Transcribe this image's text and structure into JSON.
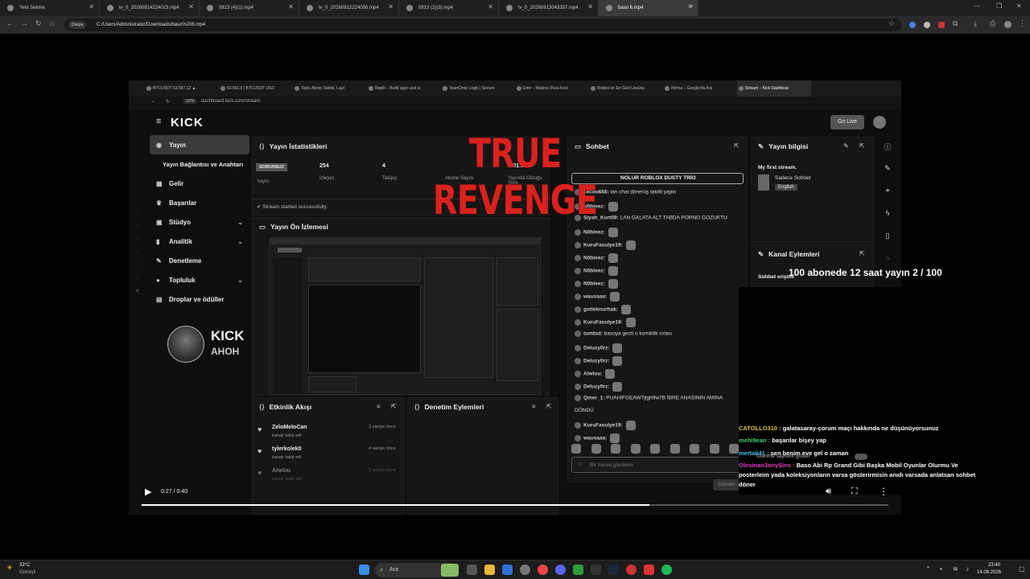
{
  "browser": {
    "tabs": [
      {
        "label": "Yeni Sekme"
      },
      {
        "label": "tv_0_20260814224023.mp4"
      },
      {
        "label": "0813 (4)(1).mp4"
      },
      {
        "label": "tv_0_20260812224056.mp4"
      },
      {
        "label": "0813 (2)(3).mp4"
      },
      {
        "label": "tv_0_20260813043357.mp4"
      },
      {
        "label": "baso 6.mp4"
      }
    ],
    "address_chip": "Dosya",
    "url": "C:/Users/Administrator/Downloads/baso%206.mp4"
  },
  "inner_browser": {
    "tabs": [
      {
        "label": "BTCUSDT 63,587,12 ▲"
      },
      {
        "label": "63,561.5 | BTCUSDT USD"
      },
      {
        "label": "Toplu Akrep Takildi, Laut"
      },
      {
        "label": "Replit – Build apps and si"
      },
      {
        "label": "TeamDrop Login | Secure"
      },
      {
        "label": "Emir – Makina (Kisa Kesi"
      },
      {
        "label": "Roblox'un En Gizli Ussünu"
      },
      {
        "label": "#drma – Google'da Ara"
      },
      {
        "label": "Stream – Kick Dashboar"
      }
    ],
    "chip": "VPN",
    "url": "dashboard.kick.com/stream"
  },
  "kick": {
    "logo": "KICK",
    "go_live": "Go Live",
    "sidebar": [
      {
        "label": "Yayın",
        "icon": "broadcast-icon"
      },
      {
        "label": "Yayın Bağlantısı ve Anahtarı"
      },
      {
        "label": "Gelir",
        "icon": "money-icon"
      },
      {
        "label": "Başarılar",
        "icon": "trophy-icon"
      },
      {
        "label": "Stüdyo",
        "icon": "studio-icon"
      },
      {
        "label": "Analitik",
        "icon": "chart-icon"
      },
      {
        "label": "Denetleme",
        "icon": "wrench-icon"
      },
      {
        "label": "Topluluk",
        "icon": "people-icon"
      },
      {
        "label": "Droplar ve ödüller",
        "icon": "gift-icon"
      }
    ],
    "card": {
      "name": "KICK",
      "sub": "AHOH"
    },
    "stats": {
      "title": "Yayın İstatistikleri",
      "status_badge": "SORUNSUZ",
      "status_label": "Yayın",
      "viewers": "254",
      "viewers_label": "İzleyici",
      "followers": "4",
      "followers_label": "Takipçi",
      "subs_label": "Abone Sayısı",
      "duration": "0:01:25",
      "duration_label": "Yayında Olduğu Süre",
      "notice": "Stream started successfully."
    },
    "preview": {
      "title": "Yayın Ön İzlemesi"
    },
    "activity": {
      "title": "Etkinlik Akışı",
      "items": [
        {
          "user": "ZeloMeloCan",
          "action": "kanalı takip etti",
          "time": "3 saniye önce"
        },
        {
          "user": "tylerkolek0",
          "action": "kanalı takip etti",
          "time": "4 saniye önce"
        },
        {
          "user": "Alwluu",
          "action": "kanalı takip etti",
          "time": "9 saniye önce"
        }
      ]
    },
    "moderation": {
      "title": "Denetim Eylemleri"
    },
    "chat": {
      "title": "Sohbet",
      "pinned": "NOLUR ROBLOX DUSTY TRİO",
      "placeholder": "Bir mesaj gönderin",
      "send": "Gönder",
      "messages": [
        {
          "user": "secoo666:",
          "text": "lan chat dönmüş takilti yapin"
        },
        {
          "user": "N0bleez:",
          "text": ""
        },
        {
          "user": "Siyah_Kurt09:",
          "text": "LAN GALATA ALT TABDA PORNO GOZUKTU"
        },
        {
          "user": "N0bleez:",
          "text": ""
        },
        {
          "user": "KuruFasulye19:",
          "text": ""
        },
        {
          "user": "N0bleez:",
          "text": ""
        },
        {
          "user": "N0bleez:",
          "text": ""
        },
        {
          "user": "N0bleez:",
          "text": ""
        },
        {
          "user": "wausaaa:",
          "text": ""
        },
        {
          "user": "gotleknurhak:",
          "text": ""
        },
        {
          "user": "KuruFasulye19:",
          "text": ""
        },
        {
          "user": "tumbul:",
          "text": "basoya gecti o komiklik sırası"
        },
        {
          "user": "Deluzy0rz:",
          "text": ""
        },
        {
          "user": "Deluzy0rz:",
          "text": ""
        },
        {
          "user": "Alwluu:",
          "text": ""
        },
        {
          "user": "Deluzy0rz:",
          "text": ""
        },
        {
          "user": "Qmer_1:",
          "text": "PUAHIFGEAW7jtgh9w7B İBRE ANASININ AMINA"
        },
        {
          "user": "",
          "text": "DÖNDÜ"
        },
        {
          "user": "KuruFasulye19:",
          "text": ""
        },
        {
          "user": "wausaaa:",
          "text": ""
        }
      ]
    },
    "stream_info": {
      "title": "Yayın bilgisi",
      "stream_title": "My first stream.",
      "category": "Sadece Sohbet",
      "language": "English"
    },
    "channel_actions": {
      "title": "Kanal Eylemleri",
      "sub": "Sohbet erişimi"
    }
  },
  "overlay": {
    "headline": "TRUE REVENGE",
    "subs_goal": "100 abonede 12 saat yayın 2 / 100",
    "messages": [
      {
        "user": "CATOLLO310 :",
        "text": "galatasaray-çorum maçı hakkında ne düşünüyorsunuz",
        "color": "#e0c040"
      },
      {
        "user": "mehi9ean :",
        "text": "başarılar bişey yap",
        "color": "#3fd07f"
      },
      {
        "user": "mertali41 :",
        "text": "sen benim eve gel o zaman",
        "color": "#40c0e0"
      },
      {
        "user": "OlesinanJonySins :",
        "text": "Baso Abi Rp Grand Gibi Başka Mobil Oyunlar Olurmu Ve posterleim yada koleksiyonların varsa gösterirmisin anıdı varsada anlatsan sohbet döner",
        "color": "#e040c0"
      }
    ],
    "viewer_toggle": "İzlenme sayısını göster"
  },
  "player": {
    "time": "0:27 / 0:40",
    "progress": 0.68
  },
  "taskbar": {
    "weather_temp": "33°C",
    "weather_desc": "Güneşli",
    "search": "Ara",
    "clock_time": "23:40",
    "clock_date": "14.08.2026"
  }
}
